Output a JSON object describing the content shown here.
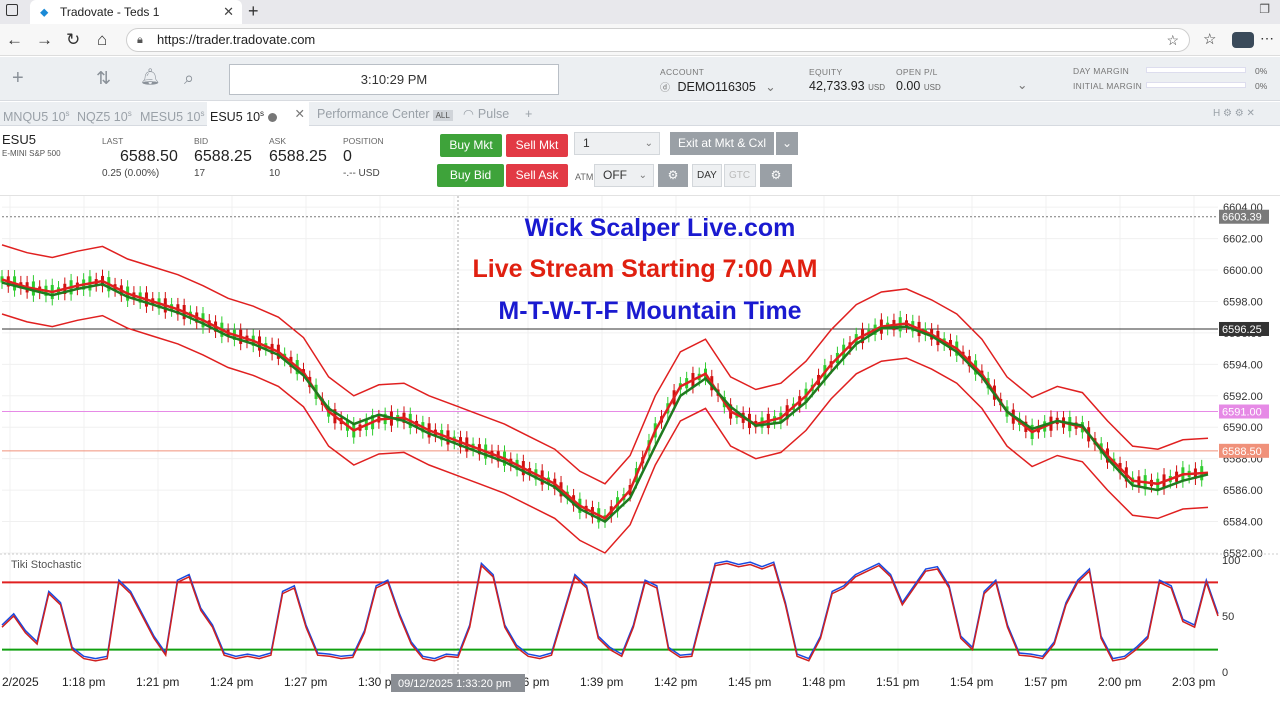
{
  "browser": {
    "tab_title": "Tradovate - Teds 1",
    "url": "https://trader.tradovate.com"
  },
  "header": {
    "clock": "3:10:29 PM",
    "account_label": "ACCOUNT",
    "account_value": "DEMO116305",
    "equity_label": "EQUITY",
    "equity_value": "42,733.93",
    "equity_unit": "USD",
    "open_pl_label": "OPEN P/L",
    "open_pl_value": "0.00",
    "open_pl_unit": "USD",
    "day_margin_label": "DAY MARGIN",
    "day_margin_pct": "0%",
    "initial_margin_label": "INITIAL MARGIN",
    "initial_margin_pct": "0%"
  },
  "modules": {
    "tabs": [
      {
        "label": "MNQU5 10",
        "sup": "s"
      },
      {
        "label": "NQZ5 10",
        "sup": "s"
      },
      {
        "label": "MESU5 10",
        "sup": "s"
      },
      {
        "label": "ESU5 10",
        "sup": "s"
      },
      {
        "label": "Performance Center",
        "badge": "ALL"
      },
      {
        "label": "Pulse"
      }
    ],
    "right_icons": "H ⚙ ⚙ ✕"
  },
  "quote": {
    "symbol": "ESU5",
    "description": "E-MINI S&P 500",
    "last_label": "LAST",
    "last_value": "6588.50",
    "last_change": "0.25 (0.00%)",
    "bid_label": "BID",
    "bid_value": "6588.25",
    "bid_size": "17",
    "ask_label": "ASK",
    "ask_value": "6588.25",
    "ask_size": "10",
    "position_label": "POSITION",
    "position_value": "0",
    "position_pl": "-.-- USD"
  },
  "trade": {
    "buy_mkt": "Buy Mkt",
    "sell_mkt": "Sell Mkt",
    "buy_bid": "Buy Bid",
    "sell_ask": "Sell Ask",
    "qty": "1",
    "exit_label": "Exit at Mkt & Cxl",
    "atm_label": "ATM",
    "atm_value": "OFF",
    "day": "DAY",
    "gtc": "GTC"
  },
  "overlay": {
    "line1": "Wick Scalper Live.com",
    "line2": "Live Stream Starting 7:00 AM",
    "line3": "M-T-W-T-F  Mountain Time",
    "line1_color": "#1a1ad0",
    "line2_color": "#e02010",
    "line3_color": "#1a1ad0"
  },
  "chart_data": {
    "type": "line",
    "title": "",
    "price_axis": {
      "ticks": [
        "6604.00",
        "6602.00",
        "6600.00",
        "6598.00",
        "6596.00",
        "6594.00",
        "6592.00",
        "6590.00",
        "6588.00",
        "6586.00",
        "6584.00",
        "6582.00"
      ],
      "ylim": [
        6582,
        6604.2
      ]
    },
    "markers": [
      {
        "label": "6603.39",
        "value": 6603.39,
        "color": "#7a7a7a"
      },
      {
        "label": "6596.25",
        "value": 6596.25,
        "color": "#333333"
      },
      {
        "label": "6591.00",
        "value": 6591.0,
        "color": "#e68ae6"
      },
      {
        "label": "6588.50",
        "value": 6588.5,
        "color": "#f0917a"
      }
    ],
    "time_axis": [
      "2/2025",
      "1:18 pm",
      "1:21 pm",
      "1:24 pm",
      "1:27 pm",
      "1:30 pm",
      "1:33 pm",
      "1:36 pm",
      "1:39 pm",
      "1:42 pm",
      "1:45 pm",
      "1:48 pm",
      "1:51 pm",
      "1:54 pm",
      "1:57 pm",
      "2:00 pm",
      "2:03 pm"
    ],
    "crosshair_label": "09/12/2025 1:33:20 pm",
    "series": [
      {
        "name": "",
        "color": "#e02020",
        "values": [
          6599.4,
          6598.9,
          6598.6,
          6599.0,
          6599.3,
          6598.5,
          6598.0,
          6597.5,
          6596.8,
          6596.0,
          6595.5,
          6594.8,
          6593.5,
          6591.0,
          6589.8,
          6590.5,
          6590.6,
          6589.8,
          6589.2,
          6588.6,
          6588.0,
          6587.2,
          6586.4,
          6585.0,
          6584.2,
          6586.0,
          6589.8,
          6592.6,
          6593.4,
          6591.0,
          6590.2,
          6590.6,
          6592.0,
          6594.0,
          6595.6,
          6596.4,
          6596.6,
          6595.9,
          6595.0,
          6593.4,
          6591.0,
          6589.7,
          6590.4,
          6590.0,
          6588.2,
          6586.6,
          6586.4,
          6587.0,
          6587.1
        ]
      },
      {
        "name": "",
        "color": "#1f7a1f",
        "values": [
          6599.2,
          6598.8,
          6598.4,
          6598.8,
          6599.1,
          6598.3,
          6597.8,
          6597.3,
          6596.6,
          6595.8,
          6595.3,
          6594.6,
          6593.3,
          6591.2,
          6590.2,
          6590.8,
          6590.4,
          6589.6,
          6589.0,
          6588.4,
          6587.8,
          6587.0,
          6586.2,
          6584.8,
          6584.0,
          6585.5,
          6588.8,
          6592.0,
          6593.1,
          6591.3,
          6590.1,
          6590.3,
          6591.6,
          6593.5,
          6595.3,
          6596.3,
          6596.4,
          6595.8,
          6594.8,
          6593.2,
          6591.0,
          6589.9,
          6590.4,
          6590.1,
          6588.0,
          6586.3,
          6586.0,
          6586.6,
          6587.0
        ]
      }
    ],
    "indicator": {
      "name": "Tiki Stochastic",
      "ticks": [
        "100",
        "50",
        "0"
      ],
      "upper": 80,
      "lower": 20,
      "values": [
        40,
        50,
        35,
        25,
        70,
        60,
        20,
        12,
        10,
        12,
        80,
        70,
        50,
        30,
        15,
        80,
        85,
        55,
        40,
        15,
        12,
        14,
        12,
        15,
        70,
        75,
        40,
        15,
        14,
        12,
        13,
        35,
        75,
        80,
        50,
        25,
        12,
        10,
        14,
        13,
        40,
        95,
        85,
        40,
        22,
        14,
        12,
        15,
        50,
        85,
        75,
        30,
        20,
        14,
        40,
        80,
        75,
        20,
        13,
        14,
        55,
        95,
        97,
        94,
        96,
        92,
        96,
        60,
        14,
        10,
        30,
        70,
        75,
        85,
        90,
        95,
        85,
        60,
        75,
        90,
        92,
        75,
        30,
        20,
        70,
        80,
        40,
        15,
        14,
        12,
        25,
        60,
        80,
        90,
        30,
        10,
        12,
        20,
        30,
        80,
        75,
        45,
        40,
        80,
        50
      ]
    }
  }
}
